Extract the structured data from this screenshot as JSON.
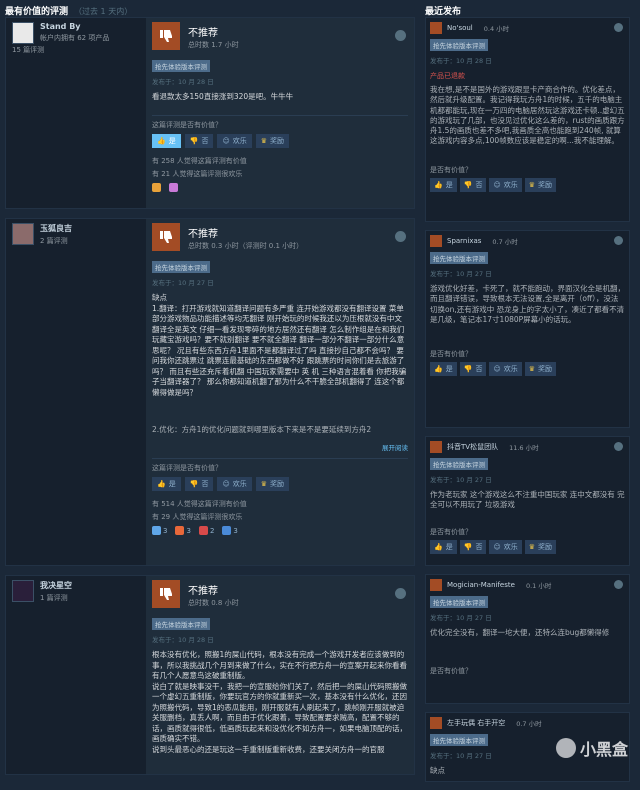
{
  "header_left": {
    "title": "最有价值的评测",
    "sub": "（过去 1 天内）"
  },
  "header_right": {
    "title": "最近发布"
  },
  "left_reviews": [
    {
      "author": "Stand By",
      "info1": "帐户内拥有 62 项产品",
      "info2": "15 篇评测",
      "verdict": "不推荐",
      "hours": "总时数 1.7 小时",
      "tag": "抢先体验版本评测",
      "posted": "发布于：10 月 28 日",
      "content": "看退款太多150直接涨到320是吧。牛牛牛",
      "helpful_q": "这篇评测是否有价值？",
      "btn_yes": "是",
      "btn_no": "否",
      "btn_funny": "欢乐",
      "btn_award": "奖励",
      "stat1": "有 258 人觉得这篇评测有价值",
      "stat2": "有 21 人觉得这篇评测很欢乐"
    },
    {
      "author": "玉狐良吉",
      "info1": "2 篇评测",
      "verdict": "不推荐",
      "hours": "总时数 0.3 小时（评测时 0.1 小时）",
      "tag": "抢先体验版本评测",
      "posted": "发布于：10 月 27 日",
      "content": "缺点\n1.翻译：打开游戏就知道翻译问题有多严重 连开始游戏都没有翻译设置 菜单 部分游戏物品功能描述等均无翻译 刚开始玩的时候我还以为压根就没有中文翻译全是英文 仔细一看发现零碎的地方居然还有翻译 怎么制作组是在和我们玩藏宝游戏吗？要不就别翻译 要不就全翻译 翻译一部分不翻译一部分什么意思呢？ 况且有些东西方舟1里面不是都翻译过了吗 直接抄自己都不会吗？ 要问我你还跳票过 跳票连最基础的东西都做不好 跟跳票的时间你们是去旅游了吗？ 而且有些还充斥着机翻 中国玩家需要中 英 机 三种语言混着看 你把我骗子当翻译器了？ 那么你都知道机翻了那为什么不干脆全部机翻得了 连这个都懒得做是吗？",
      "content2": "2.优化：方舟1的优化问题就到哪里版本下来是不是要延续到方舟2",
      "readmore": "展开阅读",
      "helpful_q": "这篇评测是否有价值？",
      "btn_yes": "是",
      "btn_no": "否",
      "btn_funny": "欢乐",
      "btn_award": "奖励",
      "stat1": "有 514 人觉得这篇评测有价值",
      "stat2": "有 29 人觉得这篇评测很欢乐",
      "awards": [
        "3",
        "3",
        "2",
        "3"
      ]
    },
    {
      "author": "我决星空",
      "info1": "1 篇评测",
      "verdict": "不推荐",
      "hours": "总时数 0.8 小时",
      "tag": "抢先体验版本评测",
      "posted": "发布于：10 月 28 日",
      "content": "根本没有优化，照搬1的屎山代码，根本没有完成一个游戏开发者应该做到的事，所以我挑战几个月到来做了什么，实在不行把方舟一的宣案开起来你看看有几个人愿意鸟这破重制版。\n说白了就是映事没干，我把一的宣服给你们关了，然后把一的屎山代码照搬做一个虚幻五重制版，你要玩官方的你就重新买一次，基本没有什么优化，还因为照搬代码，导致1的恶瓜能用，刚开服就有人刷起来了，跳帧刚开服就被迫关服删档，真丢人啊，而且由于优化跟着，导致配置要求贼高，配置不够的话，画质就得很低，低画质玩起来和没优化不如方舟一，如果电脑顶配的话，画质确实不错。\n说到头最恶心的还是玩这一手重制版重新收费，还要关闭方舟一的官服"
    }
  ],
  "right_reviews": [
    {
      "name": "No'soul",
      "hours": "0.4 小时",
      "tag": "抢先体验版本评测",
      "posted": "发布于：10 月 28 日",
      "flag": "产品已退款",
      "content": "我在想,是不是国外的游戏跟显卡产商合作的。优化差点，然后就升级配置。我记得我玩方舟1的时候，五千的电脑主机都都能玩,现在一万四的电脑居然玩这游戏还卡顿..虚幻五的游戏玩了几部，也没见过优化这么差的，rust的画质跟方舟1.5的画质也差不多吧,我画质全高也能跑到240帧, 就算这游戏内容多点,100帧数应该是稳定的啊...我不能理解。",
      "helpful_q": "是否有价值？",
      "btn_yes": "是",
      "btn_no": "否",
      "btn_funny": "欢乐",
      "btn_award": "奖励"
    },
    {
      "name": "Sparnixas",
      "hours": "0.7 小时",
      "tag": "抢先体验版本评测",
      "posted": "发布于：10 月 27 日",
      "content": "游戏优化好差，卡死了，就不能跑动，界面汉化全是机翻，而且翻译错误，导致根本无法设置,全是离开（off），没法切换on,还有游戏中 恐龙身上的字太小了，凑近了都看不清是几级，笔记本17寸1080P屏幕小的话玩。",
      "helpful_q": "是否有价值？",
      "btn_yes": "是",
      "btn_no": "否",
      "btn_funny": "欢乐",
      "btn_award": "奖励"
    },
    {
      "name": "抖音TV松鼠团队",
      "hours": "11.6 小时",
      "tag": "抢先体验版本评测",
      "posted": "发布于：10 月 27 日",
      "content": "作为老玩家 这个游戏这么不注重中国玩家 连中文都没有 完全可以不用玩了 垃圾游戏",
      "helpful_q": "是否有价值？",
      "btn_yes": "是",
      "btn_no": "否",
      "btn_funny": "欢乐",
      "btn_award": "奖励"
    },
    {
      "name": "Mogician-Manifeste",
      "hours": "0.1 小时",
      "tag": "抢先体验版本评测",
      "posted": "发布于：10 月 27 日",
      "content": "优化完全没有，翻译一坨大便，还特么连bug都懒得修",
      "helpful_q": "是否有价值？"
    },
    {
      "name": "左手玩偶 右手开空",
      "hours": "0.7 小时",
      "tag": "抢先体验版本评测",
      "posted": "发布于：10 月 27 日",
      "content": "缺点"
    }
  ],
  "watermark": "小黑盒"
}
